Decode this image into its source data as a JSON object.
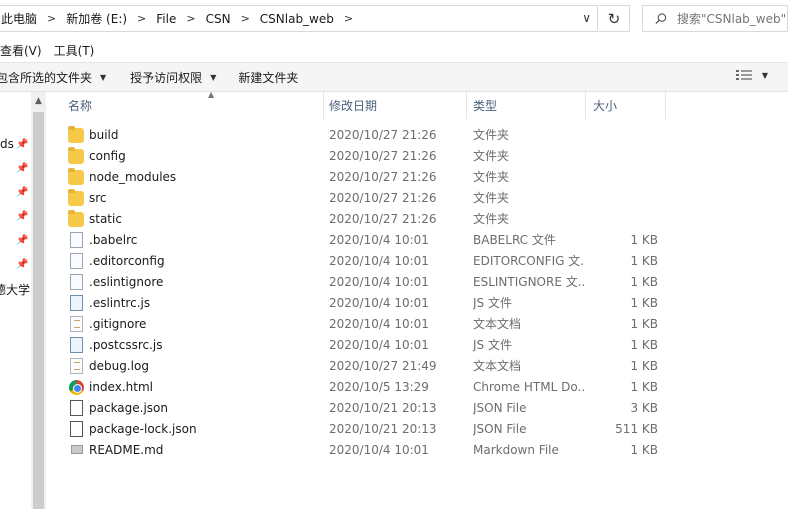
{
  "address": {
    "crumbs": [
      "此电脑",
      "新加卷 (E:)",
      "File",
      "CSN",
      "CSNlab_web"
    ],
    "dropdown_glyph": "∨",
    "refresh_glyph": "↻",
    "search_placeholder": "搜索\"CSNlab_web\""
  },
  "menu": [
    "查看(V)",
    "工具(T)"
  ],
  "toolbar": {
    "include_library": "包含所选的文件夹",
    "share": "授予访问权限",
    "new_folder": "新建文件夹"
  },
  "nav": {
    "labels": [
      "ds",
      "德大学"
    ]
  },
  "columns": {
    "name": "名称",
    "date": "修改日期",
    "type": "类型",
    "size": "大小"
  },
  "files": [
    {
      "name": "build",
      "date": "2020/10/27 21:26",
      "type": "文件夹",
      "size": "",
      "icon": "folder-icon"
    },
    {
      "name": "config",
      "date": "2020/10/27 21:26",
      "type": "文件夹",
      "size": "",
      "icon": "folder-icon"
    },
    {
      "name": "node_modules",
      "date": "2020/10/27 21:26",
      "type": "文件夹",
      "size": "",
      "icon": "folder-icon"
    },
    {
      "name": "src",
      "date": "2020/10/27 21:26",
      "type": "文件夹",
      "size": "",
      "icon": "folder-icon"
    },
    {
      "name": "static",
      "date": "2020/10/27 21:26",
      "type": "文件夹",
      "size": "",
      "icon": "folder-icon"
    },
    {
      "name": ".babelrc",
      "date": "2020/10/4 10:01",
      "type": "BABELRC 文件",
      "size": "1 KB",
      "icon": "generic-file-icon"
    },
    {
      "name": ".editorconfig",
      "date": "2020/10/4 10:01",
      "type": "EDITORCONFIG 文...",
      "size": "1 KB",
      "icon": "generic-file-icon"
    },
    {
      "name": ".eslintignore",
      "date": "2020/10/4 10:01",
      "type": "ESLINTIGNORE 文...",
      "size": "1 KB",
      "icon": "generic-file-icon"
    },
    {
      "name": ".eslintrc.js",
      "date": "2020/10/4 10:01",
      "type": "JS 文件",
      "size": "1 KB",
      "icon": "js-file-icon"
    },
    {
      "name": ".gitignore",
      "date": "2020/10/4 10:01",
      "type": "文本文档",
      "size": "1 KB",
      "icon": "text-file-icon"
    },
    {
      "name": ".postcssrc.js",
      "date": "2020/10/4 10:01",
      "type": "JS 文件",
      "size": "1 KB",
      "icon": "js-file-icon"
    },
    {
      "name": "debug.log",
      "date": "2020/10/27 21:49",
      "type": "文本文档",
      "size": "1 KB",
      "icon": "text-file-icon"
    },
    {
      "name": "index.html",
      "date": "2020/10/5 13:29",
      "type": "Chrome HTML Do...",
      "size": "1 KB",
      "icon": "chrome-icon"
    },
    {
      "name": "package.json",
      "date": "2020/10/21 20:13",
      "type": "JSON File",
      "size": "3 KB",
      "icon": "json-file-icon"
    },
    {
      "name": "package-lock.json",
      "date": "2020/10/21 20:13",
      "type": "JSON File",
      "size": "511 KB",
      "icon": "json-file-icon"
    },
    {
      "name": "README.md",
      "date": "2020/10/4 10:01",
      "type": "Markdown File",
      "size": "1 KB",
      "icon": "markdown-file-icon"
    }
  ]
}
